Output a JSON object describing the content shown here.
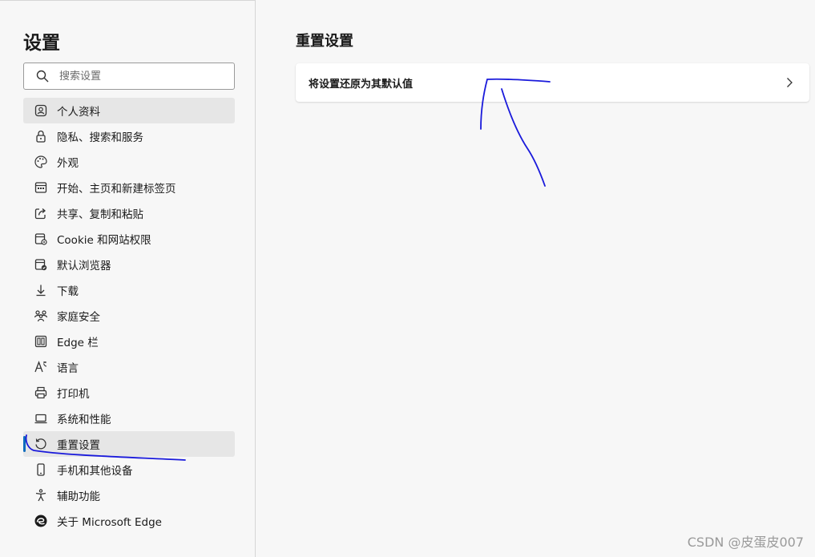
{
  "sidebar": {
    "title": "设置",
    "search": {
      "placeholder": "搜索设置",
      "value": ""
    },
    "items": [
      {
        "label": "个人资料",
        "icon": "profile-icon"
      },
      {
        "label": "隐私、搜索和服务",
        "icon": "lock-icon"
      },
      {
        "label": "外观",
        "icon": "palette-icon"
      },
      {
        "label": "开始、主页和新建标签页",
        "icon": "new-tab-icon"
      },
      {
        "label": "共享、复制和粘贴",
        "icon": "share-icon"
      },
      {
        "label": "Cookie 和网站权限",
        "icon": "site-permissions-icon"
      },
      {
        "label": "默认浏览器",
        "icon": "default-browser-icon"
      },
      {
        "label": "下载",
        "icon": "download-icon"
      },
      {
        "label": "家庭安全",
        "icon": "family-icon"
      },
      {
        "label": "Edge 栏",
        "icon": "edge-bar-icon"
      },
      {
        "label": "语言",
        "icon": "language-icon"
      },
      {
        "label": "打印机",
        "icon": "printer-icon"
      },
      {
        "label": "系统和性能",
        "icon": "laptop-icon"
      },
      {
        "label": "重置设置",
        "icon": "reset-icon",
        "active": true
      },
      {
        "label": "手机和其他设备",
        "icon": "phone-icon"
      },
      {
        "label": "辅助功能",
        "icon": "accessibility-icon"
      },
      {
        "label": "关于 Microsoft Edge",
        "icon": "edge-logo-icon"
      }
    ]
  },
  "main": {
    "title": "重置设置",
    "card": {
      "label": "将设置还原为其默认值",
      "icon": "chevron-right-icon"
    }
  },
  "watermark": "CSDN @皮蛋皮007",
  "colors": {
    "accent": "#0f6cbd",
    "annotation_ink": "#1a1adb",
    "background": "#f7f7f7"
  }
}
